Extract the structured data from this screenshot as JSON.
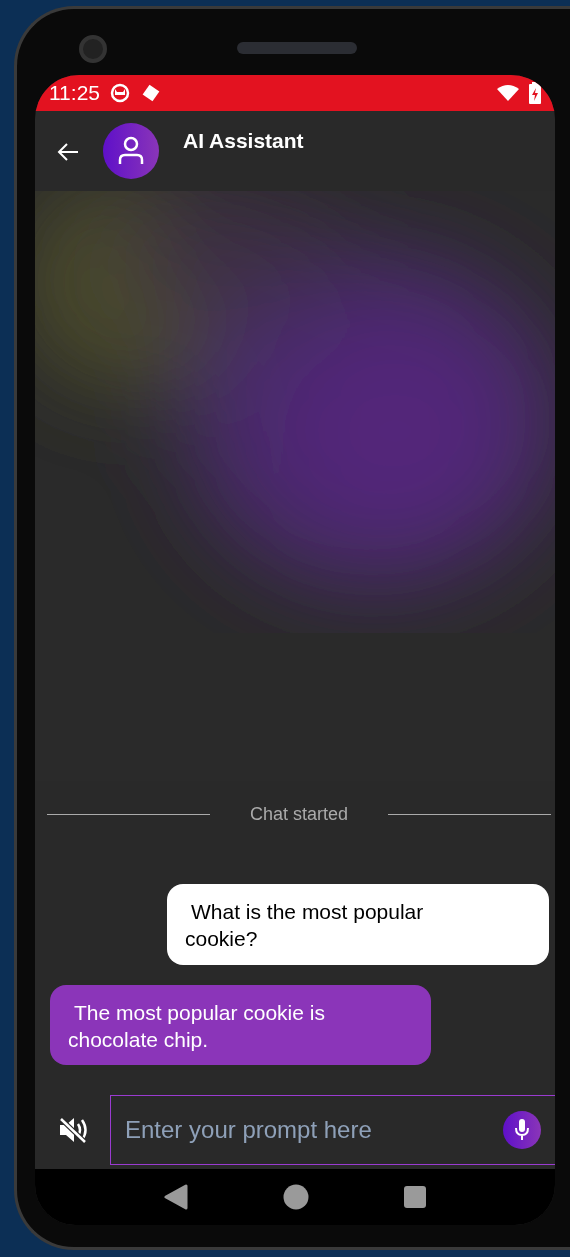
{
  "status_bar": {
    "time": "11:25"
  },
  "header": {
    "title": "AI Assistant"
  },
  "divider": {
    "label": "Chat started"
  },
  "messages": [
    {
      "kind": "user",
      "text": "What is the most popular cookie?"
    },
    {
      "kind": "assistant",
      "text": "The most popular cookie is chocolate chip."
    }
  ],
  "input": {
    "placeholder": "Enter your prompt here"
  }
}
